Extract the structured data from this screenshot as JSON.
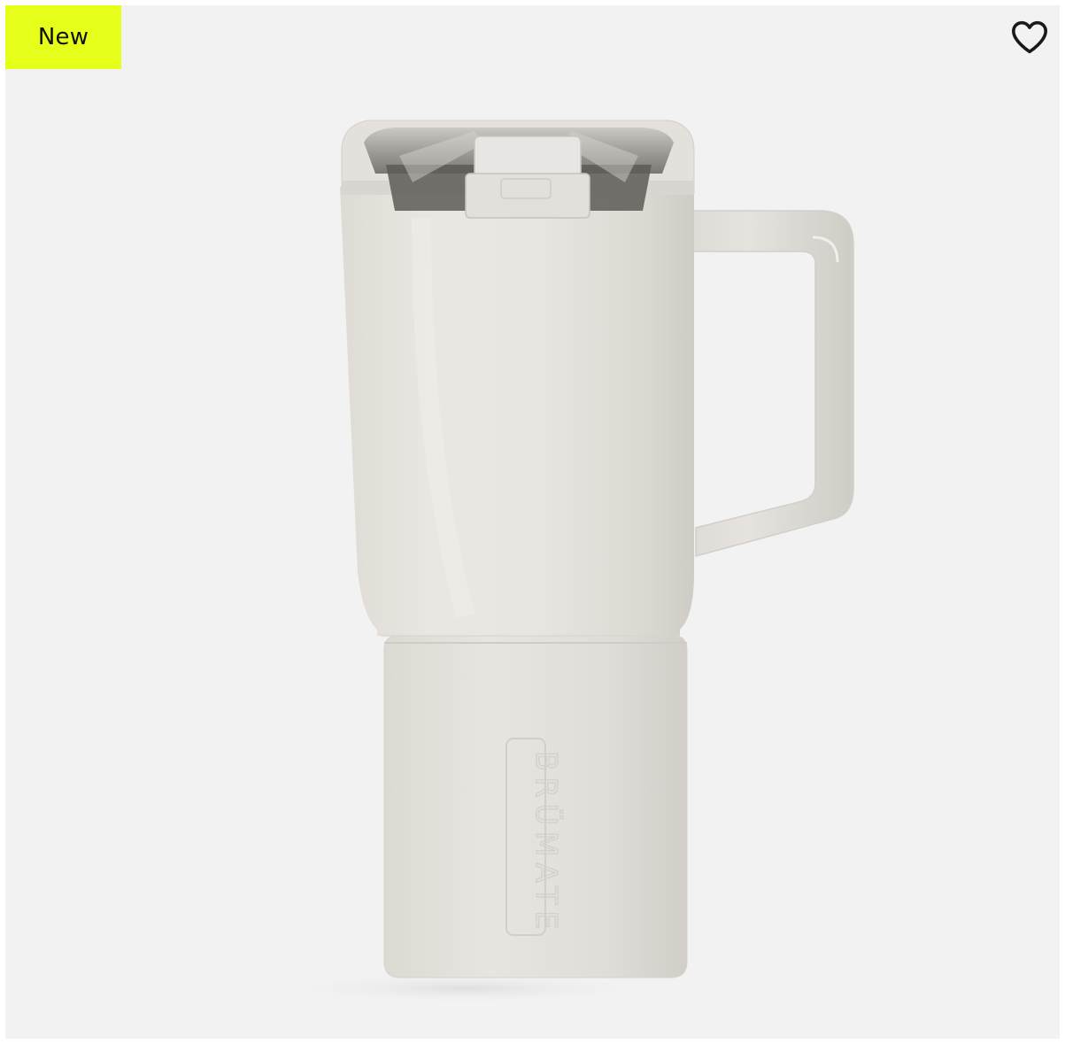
{
  "badge": {
    "label": "New"
  },
  "wishlist": {
    "icon": "heart-outline-icon"
  },
  "product": {
    "brand_mark": "BRÜMATE",
    "image_subject": "tumbler-mug-with-handle-icon"
  },
  "colors": {
    "background": "#f2f2f2",
    "badge": "#e5ff1a",
    "icon": "#1a1a1a"
  }
}
